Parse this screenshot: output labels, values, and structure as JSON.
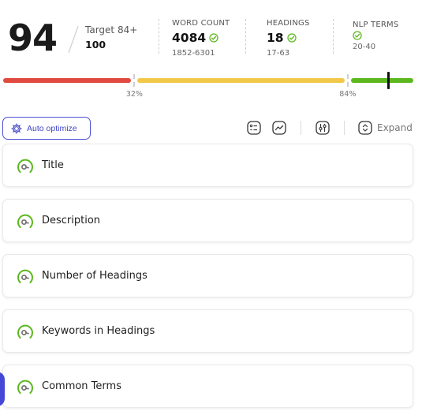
{
  "score": {
    "value": "94",
    "target_label": "Target 84+",
    "max": "100"
  },
  "stats": [
    {
      "label": "WORD COUNT",
      "value": "4084",
      "status": "ok",
      "range": "1852-6301"
    },
    {
      "label": "HEADINGS",
      "value": "18",
      "status": "ok",
      "range": "17-63"
    },
    {
      "label": "NLP TERMS",
      "value": "",
      "status": "ok",
      "range": "20-40"
    }
  ],
  "progress": {
    "current_percent": 94,
    "thresholds": [
      {
        "percent": 32,
        "label": "32%"
      },
      {
        "percent": 84,
        "label": "84%"
      }
    ],
    "colors": {
      "low": "#e04a3f",
      "mid": "#f2c84b",
      "high": "#5cb81e",
      "marker": "#111111"
    }
  },
  "toolbar": {
    "auto_optimize_label": "Auto optimize",
    "icons": [
      "checklist-icon",
      "trend-chart-icon",
      "filter-sliders-icon"
    ],
    "expand_label": "Expand"
  },
  "items": [
    {
      "label": "Title",
      "icon": "gauge-icon"
    },
    {
      "label": "Description",
      "icon": "gauge-icon"
    },
    {
      "label": "Number of Headings",
      "icon": "gauge-icon"
    },
    {
      "label": "Keywords in Headings",
      "icon": "gauge-icon"
    },
    {
      "label": "Common Terms",
      "icon": "gauge-icon"
    }
  ],
  "colors": {
    "accent": "#4a4fd6",
    "success": "#5cb81e"
  }
}
